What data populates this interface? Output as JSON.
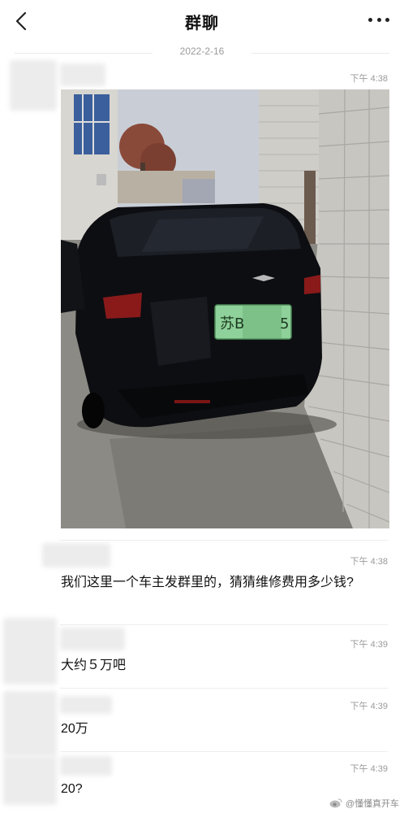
{
  "header": {
    "title": "群聊"
  },
  "date_separator": "2022-2-16",
  "messages": [
    {
      "time": "下午 4:38",
      "type": "image",
      "image_desc": "black-suv-rear-damaged-against-wall"
    },
    {
      "time": "下午 4:38",
      "text": "我们这里一个车主发群里的，猜猜维修费用多少钱?"
    },
    {
      "time": "下午 4:39",
      "text": "大约５万吧"
    },
    {
      "time": "下午 4:39",
      "text": "20万"
    },
    {
      "time": "下午 4:39",
      "text": "20?"
    }
  ],
  "photo": {
    "plate_prefix": "苏B",
    "plate_suffix": "5"
  },
  "watermark": {
    "text": "@懂懂真开车"
  },
  "colors": {
    "plate_green": "#8fd19a",
    "car_black": "#0d0e12",
    "wall": "#c9c7c2"
  },
  "icons": {
    "back": "back-chevron-icon",
    "more": "more-dots-icon"
  }
}
